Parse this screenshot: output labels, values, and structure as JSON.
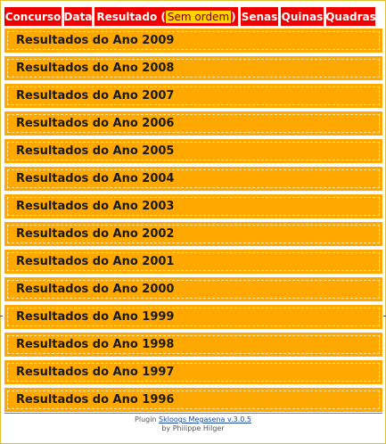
{
  "header": {
    "concurso": "Concurso",
    "data": "Data",
    "resultado_prefix": "Resultado (",
    "resultado_tag": "Sem ordem",
    "resultado_suffix": ")",
    "senas": "Senas",
    "quinas": "Quinas",
    "quadras": "Quadras"
  },
  "years": [
    {
      "label": "Resultados do Ano 2009"
    },
    {
      "label": "Resultados do Ano 2008"
    },
    {
      "label": "Resultados do Ano 2007"
    },
    {
      "label": "Resultados do Ano 2006"
    },
    {
      "label": "Resultados do Ano 2005"
    },
    {
      "label": "Resultados do Ano 2004"
    },
    {
      "label": "Resultados do Ano 2003"
    },
    {
      "label": "Resultados do Ano 2002"
    },
    {
      "label": "Resultados do Ano 2001"
    },
    {
      "label": "Resultados do Ano 2000"
    },
    {
      "label": "Resultados do Ano 1999"
    },
    {
      "label": "Resultados do Ano 1998"
    },
    {
      "label": "Resultados do Ano 1997"
    },
    {
      "label": "Resultados do Ano 1996"
    }
  ],
  "footer": {
    "plugin_prefix": "Plugin ",
    "plugin_link": "Skloogs Megasena v.3.0.5",
    "byline": "by Philippe Hilger"
  },
  "colors": {
    "header_bg": "#ee0000",
    "tag_bg": "#ffd200",
    "year_bar_bg": "#ffa800"
  }
}
